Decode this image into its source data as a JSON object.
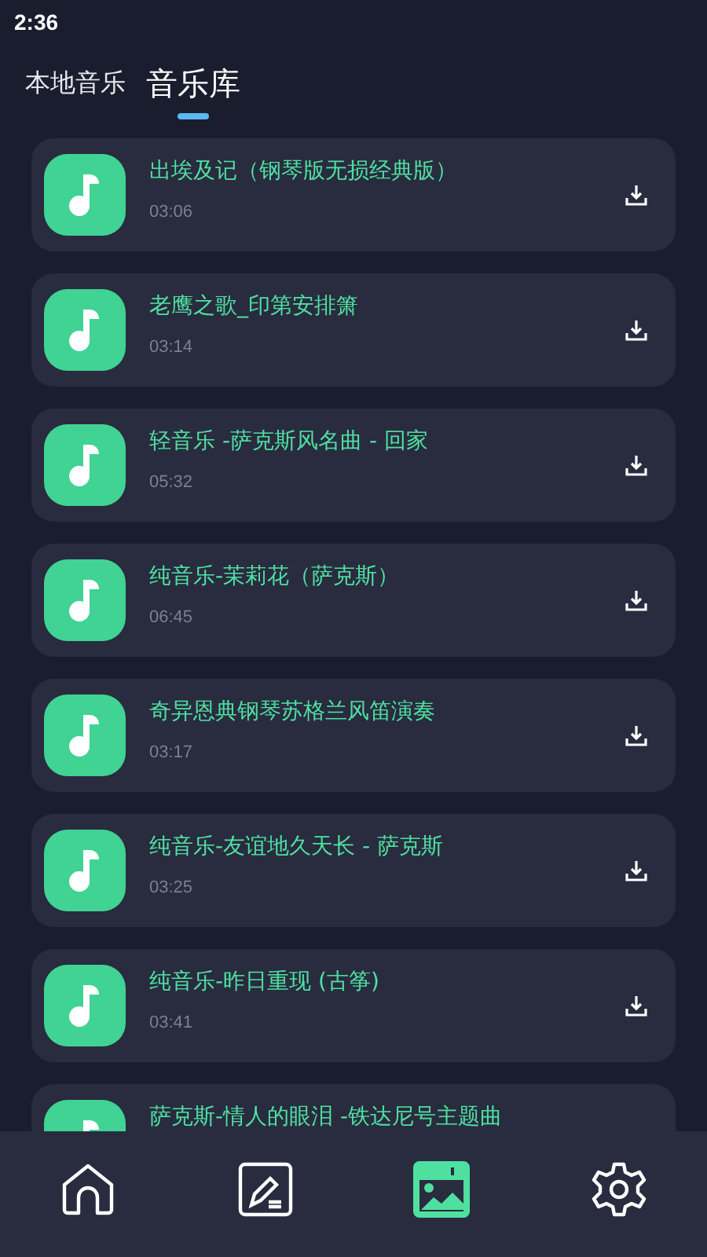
{
  "status_bar": {
    "time": "2:36"
  },
  "tabs": [
    {
      "label": "本地音乐",
      "selected": false
    },
    {
      "label": "音乐库",
      "selected": true
    }
  ],
  "songs": [
    {
      "title": "出埃及记（钢琴版无损经典版）",
      "duration": "03:06"
    },
    {
      "title": "老鹰之歌_印第安排箫",
      "duration": "03:14"
    },
    {
      "title": "轻音乐 -萨克斯风名曲 - 回家",
      "duration": "05:32"
    },
    {
      "title": "纯音乐-茉莉花（萨克斯）",
      "duration": "06:45"
    },
    {
      "title": "奇异恩典钢琴苏格兰风笛演奏",
      "duration": "03:17"
    },
    {
      "title": "纯音乐-友谊地久天长 - 萨克斯",
      "duration": "03:25"
    },
    {
      "title": "纯音乐-昨日重现 (古筝)",
      "duration": "03:41"
    },
    {
      "title": "萨克斯-情人的眼泪 -铁达尼号主题曲"
    }
  ],
  "bottom_nav": [
    {
      "kind": "home",
      "selected": false
    },
    {
      "kind": "edit",
      "selected": false
    },
    {
      "kind": "library",
      "selected": true
    },
    {
      "kind": "settings",
      "selected": false
    }
  ]
}
